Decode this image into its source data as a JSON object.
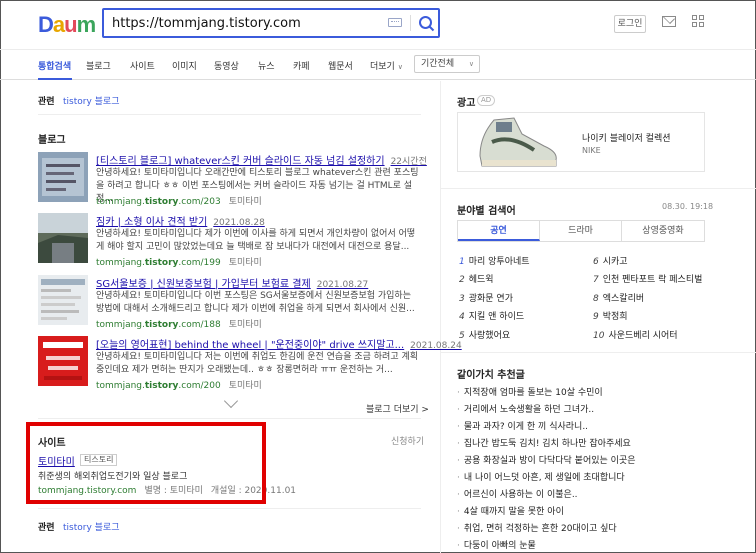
{
  "header": {
    "logo": "Daum",
    "search_query": "https://tommjang.tistory.com",
    "login_label": "로그인"
  },
  "tabs": [
    {
      "label": "통합검색",
      "active": true
    },
    {
      "label": "블로그"
    },
    {
      "label": "사이트"
    },
    {
      "label": "이미지"
    },
    {
      "label": "동영상"
    },
    {
      "label": "뉴스"
    },
    {
      "label": "카페"
    },
    {
      "label": "웹문서"
    },
    {
      "label": "더보기"
    }
  ],
  "period_filter": "기간전체",
  "related": {
    "label": "관련",
    "value": "tistory 블로그"
  },
  "blog": {
    "title": "블로그",
    "more_label": "블로그 더보기 >",
    "items": [
      {
        "title": "[티스토리 블로그] whatever스킨 커버 슬라이드 자동 넘김 설정하기",
        "date": "22시간전",
        "snippet": "안녕하세요! 토미타미입니다 오래간만에 티스토리 블로그 whatever스킨 관련 포스팅을 하려고 합니다 ㅎㅎ 이번 포스팅에서는 커버 슬라이드 자동 넘기는 걸 HTML로 설정...",
        "url_prefix": "tommjang.",
        "url_bold": "tistory",
        "url_suffix": ".com/203",
        "author": "토미타미"
      },
      {
        "title": "짐카 | 소형 이사 견적 받기",
        "date": "2021.08.28",
        "snippet": "안녕하세요! 토미타미입니다 제가 이번에 이사를 하게 되면서 개인차량이 없어서 어떻게 해야 할지 고민이 많았었는데요 늘 택배로 잠 보내다가 대전에서 대전으로 용달...",
        "url_prefix": "tommjang.",
        "url_bold": "tistory",
        "url_suffix": ".com/199",
        "author": "토미타미"
      },
      {
        "title": "SG서울보증 | 신원보증보험 | 가입부터 보험료 결제",
        "date": "2021.08.27",
        "snippet": "안녕하세요! 토미타미입니다 이번 포스팅은 SG서울보증에서 신원보증보험 가입하는 방법에 대해서 소개해드리고 합니다 제가 이번에 취업을 하게 되면서 회사에서 신원...",
        "url_prefix": "tommjang.",
        "url_bold": "tistory",
        "url_suffix": ".com/188",
        "author": "토미타미"
      },
      {
        "title": "[오늘의 영어표현] behind the wheel | \"운전중이야\" drive 쓰지말고...",
        "date": "2021.08.24",
        "snippet": "안녕하세요! 토미타미입니다 저는 이번에 취업도 한김에 운전 연습을 조금 하려고 계획 중인데요 제가 면허는 딴지가 오래됐는데.. ㅎㅎ 장롱면허라 ㅠㅠ 운전하는 거...",
        "url_prefix": "tommjang.",
        "url_bold": "tistory",
        "url_suffix": ".com/200",
        "author": "토미타미"
      }
    ]
  },
  "site": {
    "title": "사이트",
    "register_label": "신청하기",
    "name": "토미타미",
    "badge": "티스토리",
    "description": "취준생의 해외취업도전기와 일상 블로그",
    "url": "tommjang.tistory.com",
    "alias": "별명 : 토미타미",
    "opened": "개설일 : 2020.11.01"
  },
  "related_bottom": {
    "label": "관련",
    "value": "tistory 블로그"
  },
  "ad": {
    "title": "광고",
    "badge": "AD",
    "product": "나이키 블레이저 컬렉션",
    "brand": "NIKE"
  },
  "ranking": {
    "title": "분야별 검색어",
    "date": "08.30. 19:18",
    "tabs": [
      "공연",
      "드라마",
      "상영중영화"
    ],
    "items": [
      {
        "n": "1",
        "text": "마리 앙투아네트"
      },
      {
        "n": "2",
        "text": "헤드윅"
      },
      {
        "n": "3",
        "text": "광화문 연가"
      },
      {
        "n": "4",
        "text": "지킬 앤 하이드"
      },
      {
        "n": "5",
        "text": "사랑했어요"
      },
      {
        "n": "6",
        "text": "시카고"
      },
      {
        "n": "7",
        "text": "인천 펜타포트 락 페스티벌"
      },
      {
        "n": "8",
        "text": "엑스칼리버"
      },
      {
        "n": "9",
        "text": "박정희"
      },
      {
        "n": "10",
        "text": "사운드베리 시어터"
      }
    ]
  },
  "recommend": {
    "title": "같이가치 추천글",
    "items": [
      "지적장애 엄마를 돌보는 10살 수민이",
      "거리에서 노숙생활을 하던 그녀가..",
      "물과 과자? 이게 한 끼 식사라니..",
      "집나간 밥도둑 김치! 김치 하나만 잡아주세요",
      "공용 화장실과 방이 다닥다닥 붙어있는 이곳은",
      "내 나이 어느덧 아흔, 제 생일에 초대합니다",
      "어르신이 사용하는 이 이불은..",
      "4살 때까지 말을 못한 아이",
      "취업, 면허 걱정하는 흔한 20대이고 싶다",
      "다둥이 아빠의 눈물"
    ]
  },
  "colors": {
    "accent": "#3b5bdb",
    "highlight_box": "#e00000"
  }
}
